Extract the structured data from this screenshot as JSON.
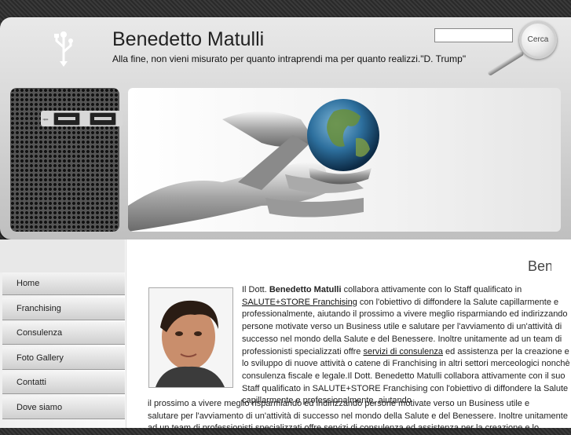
{
  "header": {
    "title": "Benedetto Matulli",
    "tagline": "Alla fine, non vieni misurato per quanto intraprendi ma per quanto realizzi.\"D. Trump\"",
    "search_button_label": "Cerca",
    "search_value": ""
  },
  "usb_symbol": "⭼",
  "nav": {
    "items": [
      "Home",
      "Franchising",
      "Consulenza",
      "Foto Gallery",
      "Contatti",
      "Dove siamo"
    ]
  },
  "main": {
    "heading": "Benvenuti",
    "p1_start": "Il Dott. ",
    "name_bold": "Benedetto Matulli",
    "p1_a": " collabora attivamente con lo Staff qualificato in ",
    "link_salute": "SALUTE+STORE Franchising",
    "p1_b": " con l'obiettivo di diffondere la Salute capillarmente e professionalmente, aiutando il prossimo a vivere meglio risparmiando ed indirizzando persone motivate verso un Business utile e salutare per l'avviamento di un'attività di successo nel mondo della Salute e del Benessere. Inoltre unitamente ad un team di professionisti specializzati offre ",
    "link_consulenza": "servizi di consulenza",
    "p1_c": " ed assistenza per la creazione e lo sviluppo di nuove attività o catene di Franchising in altri settori merceologici nonchè consulenza fiscale e legale.Il Dott. Benedetto Matulli collabora attivamente con il suo Staff qualificato in SALUTE+STORE Franchising con l'obiettivo di diffondere la Salute capillarmente e professionalmente, aiutando",
    "line_a": "il prossimo a vivere meglio risparmiando ed indirizzando persone motivate verso un Business utile e",
    "line_b": "salutare per l'avviamento di un'attività di successo nel mondo della Salute e del Benessere. Inoltre unitamente",
    "line_c": "ad un team di professionisti specializzati offre servizi di consulenza ed assistenza per la creazione e lo"
  }
}
